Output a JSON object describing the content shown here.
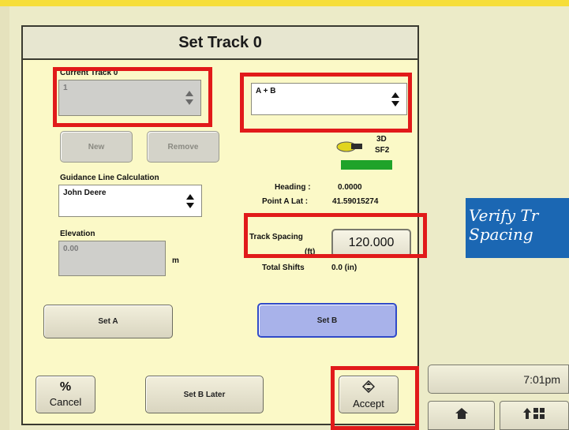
{
  "dialog": {
    "title": "Set Track 0",
    "current_track": {
      "label": "Current Track 0",
      "value": "1"
    },
    "method": {
      "value": "A + B"
    },
    "new_label": "New",
    "remove_label": "Remove",
    "gps": {
      "mode": "3D",
      "signal": "SF2"
    },
    "guidance": {
      "label": "Guidance Line Calculation",
      "value": "John Deere"
    },
    "heading": {
      "label": "Heading :",
      "value": "0.0000"
    },
    "point_a_lat": {
      "label": "Point A Lat :",
      "value": "41.59015274"
    },
    "elevation": {
      "label": "Elevation",
      "value": "0.00",
      "unit": "m"
    },
    "track_spacing": {
      "label": "Track Spacing",
      "unit": "(ft)",
      "value": "120.000"
    },
    "total_shifts": {
      "label": "Total Shifts",
      "value": "0.0 (in)"
    },
    "set_a_label": "Set A",
    "set_b_label": "Set B",
    "cancel_label": "Cancel",
    "set_b_later_label": "Set B Later",
    "accept_label": "Accept"
  },
  "caption": {
    "line1": "Verify Tr",
    "line2": "Spacing"
  },
  "status": {
    "time": "7:01pm"
  },
  "colors": {
    "highlight": "#e11a1a",
    "caption_bg": "#1b67b3",
    "set_b_bg": "#a8b2ea",
    "signal_bar": "#1fa32a"
  },
  "icons": [
    "chevron-updown-icon",
    "gps-receiver-icon",
    "cancel-slash-icon",
    "accept-arrow-icon",
    "home-icon",
    "menu-up-icon"
  ]
}
